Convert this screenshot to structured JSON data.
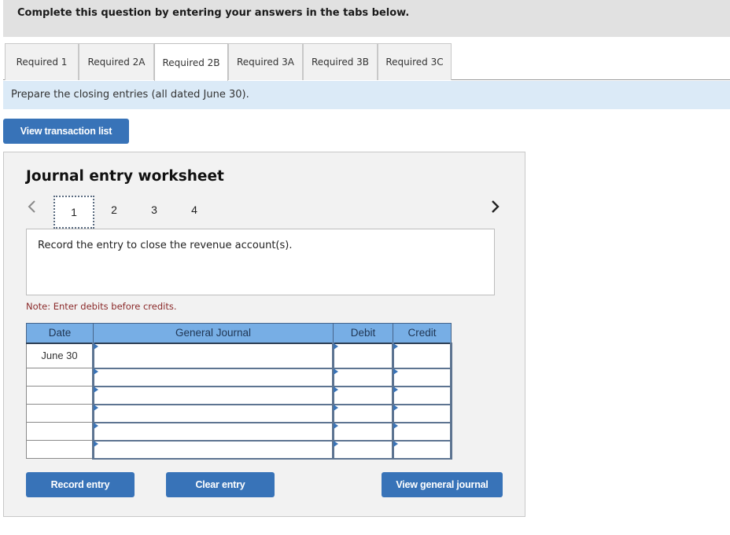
{
  "banner": {
    "text": "Complete this question by entering your answers in the tabs below."
  },
  "tabs": [
    {
      "label": "Required 1",
      "active": false
    },
    {
      "label": "Required 2A",
      "active": false
    },
    {
      "label": "Required 2B",
      "active": true
    },
    {
      "label": "Required 3A",
      "active": false
    },
    {
      "label": "Required 3B",
      "active": false
    },
    {
      "label": "Required 3C",
      "active": false
    }
  ],
  "instruction": "Prepare the closing entries (all dated June 30).",
  "view_transaction_list_label": "View transaction list",
  "worksheet": {
    "title": "Journal entry worksheet",
    "pages": [
      "1",
      "2",
      "3",
      "4"
    ],
    "current_page": "1",
    "prev_icon": "chevron-left-icon",
    "next_icon": "chevron-right-icon",
    "prompt": "Record the entry to close the revenue account(s).",
    "note": "Note: Enter debits before credits.",
    "table": {
      "headers": {
        "date": "Date",
        "general_journal": "General Journal",
        "debit": "Debit",
        "credit": "Credit"
      },
      "rows": [
        {
          "date": "June 30",
          "account": "",
          "debit": "",
          "credit": ""
        },
        {
          "date": "",
          "account": "",
          "debit": "",
          "credit": ""
        },
        {
          "date": "",
          "account": "",
          "debit": "",
          "credit": ""
        },
        {
          "date": "",
          "account": "",
          "debit": "",
          "credit": ""
        },
        {
          "date": "",
          "account": "",
          "debit": "",
          "credit": ""
        },
        {
          "date": "",
          "account": "",
          "debit": "",
          "credit": ""
        }
      ]
    },
    "buttons": {
      "record": "Record entry",
      "clear": "Clear entry",
      "view_journal": "View general journal"
    }
  },
  "colors": {
    "button": "#3873b8",
    "table_header": "#77aee5",
    "instruction_bg": "#dbeaf7",
    "note_text": "#8b2a2a"
  }
}
